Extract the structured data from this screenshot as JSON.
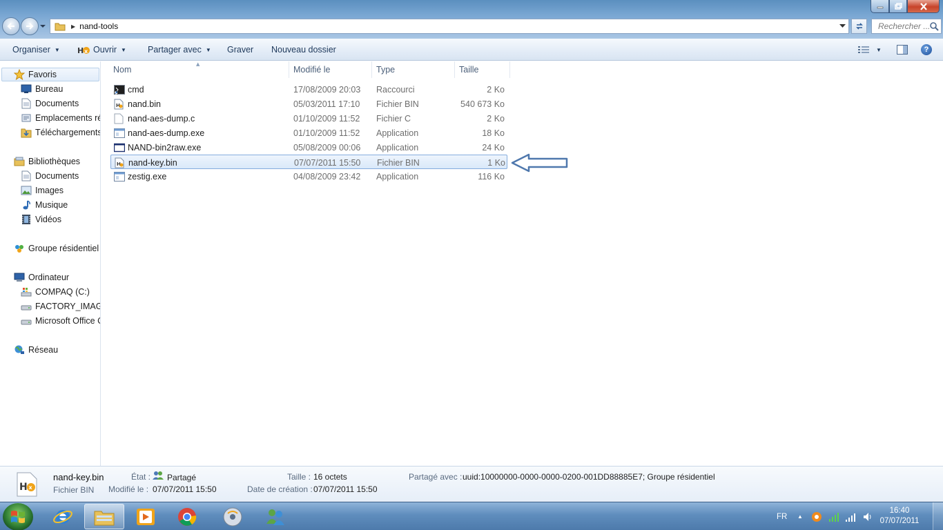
{
  "window": {
    "address": {
      "current_folder": "nand-tools"
    },
    "search": {
      "placeholder": "Rechercher ..."
    }
  },
  "toolbar": {
    "organize": "Organiser",
    "open": "Ouvrir",
    "share": "Partager avec",
    "burn": "Graver",
    "new_folder": "Nouveau dossier"
  },
  "nav": {
    "favorites": {
      "label": "Favoris",
      "items": [
        "Bureau",
        "Documents",
        "Emplacements récents",
        "Téléchargements"
      ]
    },
    "libraries": {
      "label": "Bibliothèques",
      "items": [
        "Documents",
        "Images",
        "Musique",
        "Vidéos"
      ]
    },
    "homegroup": "Groupe résidentiel",
    "computer": {
      "label": "Ordinateur",
      "items": [
        "COMPAQ (C:)",
        "FACTORY_IMAGE (D:)",
        "Microsoft Office Click-to-Run"
      ]
    },
    "network": "Réseau"
  },
  "columns": {
    "name": "Nom",
    "modified": "Modifié le",
    "type": "Type",
    "size": "Taille"
  },
  "files": [
    {
      "name": "cmd",
      "modified": "17/08/2009 20:03",
      "type": "Raccourci",
      "size": "2 Ko",
      "icon": "shortcut-icon"
    },
    {
      "name": "nand.bin",
      "modified": "05/03/2011 17:10",
      "type": "Fichier BIN",
      "size": "540 673 Ko",
      "icon": "bin-file-icon"
    },
    {
      "name": "nand-aes-dump.c",
      "modified": "01/10/2009 11:52",
      "type": "Fichier C",
      "size": "2 Ko",
      "icon": "c-file-icon"
    },
    {
      "name": "nand-aes-dump.exe",
      "modified": "01/10/2009 11:52",
      "type": "Application",
      "size": "18 Ko",
      "icon": "exe-file-icon"
    },
    {
      "name": "NAND-bin2raw.exe",
      "modified": "05/08/2009 00:06",
      "type": "Application",
      "size": "24 Ko",
      "icon": "exe-window-icon"
    },
    {
      "name": "nand-key.bin",
      "modified": "07/07/2011 15:50",
      "type": "Fichier BIN",
      "size": "1 Ko",
      "icon": "bin-file-icon",
      "selected": true
    },
    {
      "name": "zestig.exe",
      "modified": "04/08/2009 23:42",
      "type": "Application",
      "size": "116 Ko",
      "icon": "exe-file-icon"
    }
  ],
  "details": {
    "name": "nand-key.bin",
    "type": "Fichier BIN",
    "state_label": "État :",
    "state_value": "Partagé",
    "modified_label": "Modifié le :",
    "modified_value": "07/07/2011 15:50",
    "size_label": "Taille :",
    "size_value": "16 octets",
    "created_label": "Date de création :",
    "created_value": "07/07/2011 15:50",
    "shared_label": "Partagé avec :",
    "shared_value": "uuid:10000000-0000-0000-0200-001DD88885E7; Groupe résidentiel"
  },
  "taskbar": {
    "language": "FR",
    "time": "16:40",
    "date": "07/07/2011",
    "apps": [
      "ie-icon",
      "explorer-icon",
      "media-player-icon",
      "chrome-icon",
      "dvd-maker-icon",
      "messenger-icon"
    ]
  },
  "colors": {
    "selection_border": "#84acdd",
    "arrow": "#4f78ad",
    "taskbar": "#5f8dbd"
  }
}
